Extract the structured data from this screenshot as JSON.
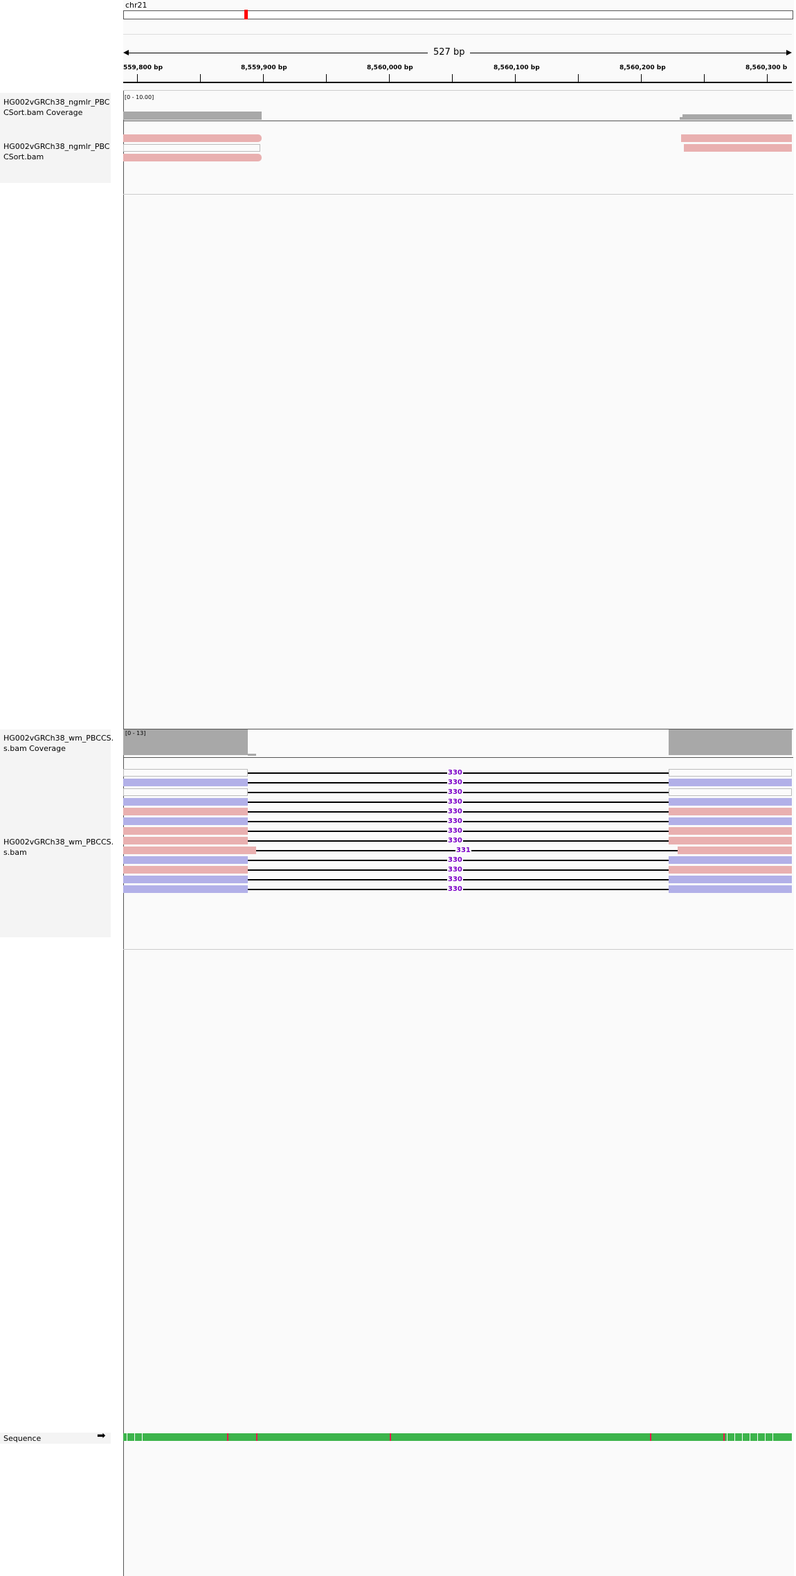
{
  "ruler": {
    "chromosome": "chr21",
    "span_label": "527 bp",
    "ticks": [
      "559,800 bp",
      "8,559,900 bp",
      "8,560,000 bp",
      "8,560,100 bp",
      "8,560,200 bp",
      "8,560,300 b"
    ]
  },
  "tracks": {
    "ngmlr_coverage": {
      "name": "HG002vGRCh38_ngmlr_PBCCSort.bam Coverage",
      "range": "[0 - 10.00]"
    },
    "ngmlr_reads": {
      "name": "HG002vGRCh38_ngmlr_PBCCSort.bam"
    },
    "wm_coverage": {
      "name": "HG002vGRCh38_wm_PBCCS.s.bam Coverage",
      "range": "[0 - 13]"
    },
    "wm_reads": {
      "name": "HG002vGRCh38_wm_PBCCS.s.bam"
    },
    "sequence": {
      "name": "Sequence",
      "strand_arrow": "➡"
    }
  },
  "colors": {
    "read_forward": "#e9b0b0",
    "read_reverse": "#b2b0e8",
    "read_lowmapq": "#fbfbfb",
    "coverage": "#a8a8a8",
    "insertion_label": "#7b00c8",
    "ideogram_marker": "#ff0000"
  },
  "deletion_reads": [
    {
      "strand": "none",
      "label": "330"
    },
    {
      "strand": "reverse",
      "label": "330"
    },
    {
      "strand": "none",
      "label": "330"
    },
    {
      "strand": "reverse",
      "label": "330"
    },
    {
      "strand": "forward",
      "label": "330"
    },
    {
      "strand": "reverse",
      "label": "330"
    },
    {
      "strand": "forward",
      "label": "330"
    },
    {
      "strand": "forward",
      "label": "330"
    },
    {
      "strand": "forward",
      "label": "331"
    },
    {
      "strand": "reverse",
      "label": "330"
    },
    {
      "strand": "forward",
      "label": "330"
    },
    {
      "strand": "reverse",
      "label": "330"
    },
    {
      "strand": "reverse",
      "label": "330"
    }
  ]
}
